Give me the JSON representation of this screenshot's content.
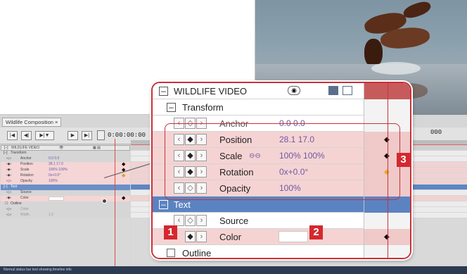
{
  "composition_tab": "Wildlife Composition ×",
  "small_timeline": {
    "timecode": "0:00:00:00",
    "timecode_right": "000",
    "toolbar_buttons": [
      "|◀",
      "◀|",
      "▶|▼",
      "▶",
      "▶|"
    ],
    "rows": [
      {
        "label": "WILDLIFE VIDEO",
        "style": "header"
      },
      {
        "label": "Transform",
        "style": "white"
      },
      {
        "label": "Anchor",
        "value": "0.0  0.0",
        "style": "white"
      },
      {
        "label": "Position",
        "value": "28.1  17.0",
        "style": "pink"
      },
      {
        "label": "Scale",
        "value": "100%  100%",
        "style": "pink"
      },
      {
        "label": "Rotation",
        "value": "0x+0.0°",
        "style": "pink"
      },
      {
        "label": "Opacity",
        "value": "100%",
        "style": "pink"
      },
      {
        "label": "Text",
        "style": "blue"
      },
      {
        "label": "Source",
        "style": "white"
      },
      {
        "label": "Color",
        "style": "pink"
      },
      {
        "label": "Outline",
        "style": "white"
      },
      {
        "label": "Color",
        "style": "white"
      },
      {
        "label": "Width",
        "value": "1.0",
        "style": "white"
      }
    ]
  },
  "zoom": {
    "header": "WILDLIFE VIDEO",
    "transform": "Transform",
    "anchor": {
      "label": "Anchor",
      "value": "0.0  0.0"
    },
    "position": {
      "label": "Position",
      "value": "28.1  17.0"
    },
    "scale": {
      "label": "Scale",
      "value": "100%  100%"
    },
    "rotation": {
      "label": "Rotation",
      "value": "0x+0.0°"
    },
    "opacity": {
      "label": "Opacity",
      "value": "100%"
    },
    "text": "Text",
    "source": "Source",
    "color": "Color",
    "outline": "Outline"
  },
  "badges": [
    "1",
    "2",
    "3"
  ],
  "status_text": "Normal status bar text showing timeline info",
  "colors": {
    "accent_red": "#c8323a",
    "badge_red": "#d4282e",
    "selected_blue": "#5b83c2",
    "pink_row": "#f6d3d3"
  }
}
